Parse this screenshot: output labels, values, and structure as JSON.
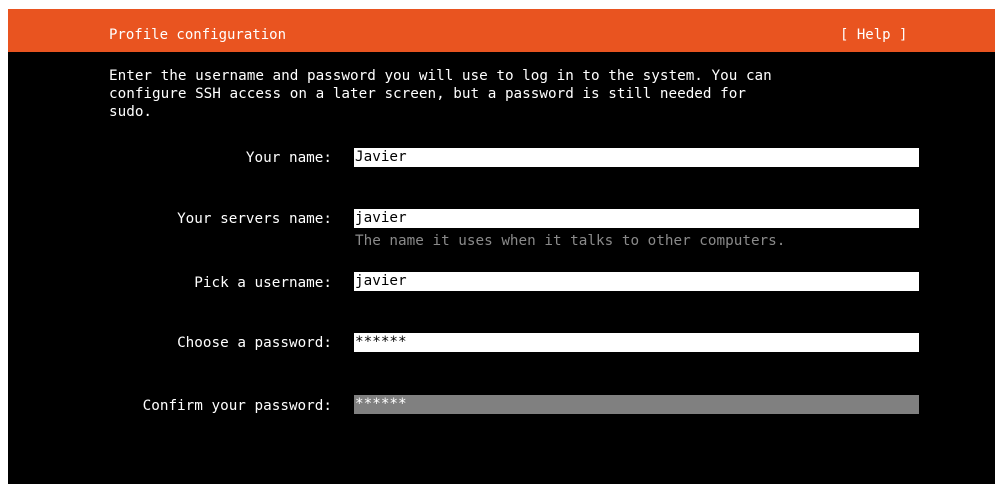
{
  "header": {
    "title": "Profile configuration",
    "help_label": "[ Help ]"
  },
  "intro_text": "Enter the username and password you will use to log in to the system. You can\nconfigure SSH access on a later screen, but a password is still needed for\nsudo.",
  "form": {
    "name": {
      "label": "Your name:",
      "value": "Javier"
    },
    "server_name": {
      "label": "Your servers name:",
      "value": "javier",
      "hint": "The name it uses when it talks to other computers."
    },
    "username": {
      "label": "Pick a username:",
      "value": "javier"
    },
    "password": {
      "label": "Choose a password:",
      "value": "******"
    },
    "confirm_password": {
      "label": "Confirm your password:",
      "value": "******"
    }
  },
  "colors": {
    "header_bg": "#e95420",
    "screen_bg": "#000000",
    "field_bg": "#ffffff",
    "focused_field_bg": "#808080",
    "hint_text": "#8a8a8a"
  }
}
